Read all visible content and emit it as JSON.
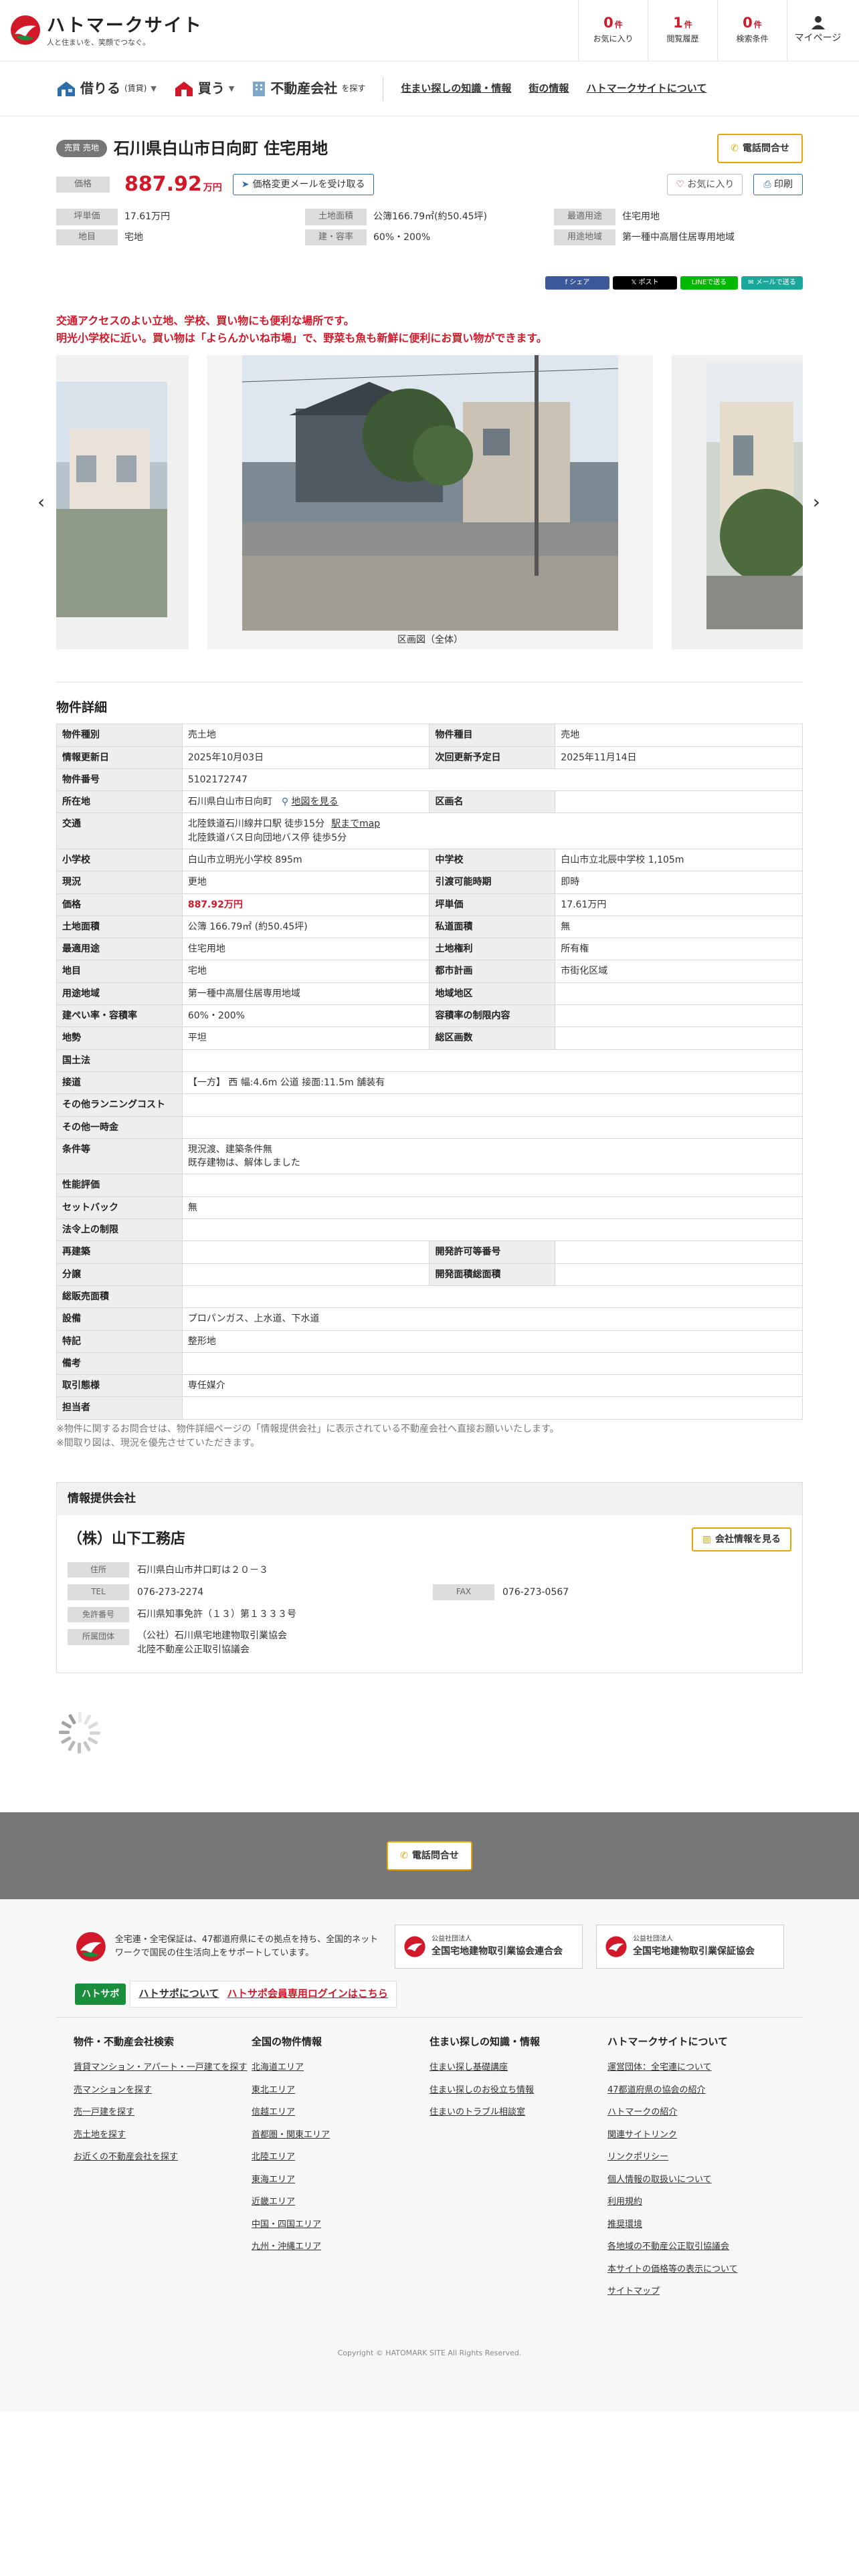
{
  "header": {
    "logo_name": "ハトマークサイト",
    "logo_tagline": "人と住まいを、笑顔でつなぐ。",
    "stats": [
      {
        "count": "0",
        "unit": "件",
        "label": "お気に入り"
      },
      {
        "count": "1",
        "unit": "件",
        "label": "閲覧履歴"
      },
      {
        "count": "0",
        "unit": "件",
        "label": "検索条件"
      }
    ],
    "mypage_label": "マイページ"
  },
  "nav": {
    "rent": {
      "label": "借りる",
      "sub": "(賃貸)"
    },
    "buy": {
      "label": "買う"
    },
    "realtor": {
      "label": "不動産会社",
      "sub": "を探す"
    },
    "links": [
      "住まい探しの知識・情報",
      "街の情報",
      "ハトマークサイトについて"
    ]
  },
  "property": {
    "badge": "売買 売地",
    "title": "石川県白山市日向町 住宅用地",
    "tel_button": "電話問合せ",
    "price_label": "価格",
    "price_value": "887.92",
    "price_unit": "万円",
    "mail_button": "価格変更メールを受け取る",
    "fav_button": "お気に入り",
    "print_button": "印刷",
    "specs": [
      {
        "label": "坪単価",
        "value": "17.61万円"
      },
      {
        "label": "土地面積",
        "value": "公簿166.79㎡(約50.45坪)"
      },
      {
        "label": "最適用途",
        "value": "住宅用地"
      },
      {
        "label": "地目",
        "value": "宅地"
      },
      {
        "label": "建・容率",
        "value": "60%・200%"
      },
      {
        "label": "用途地域",
        "value": "第一種中高層住居専用地域"
      }
    ],
    "share": [
      "シェア",
      "ポスト",
      "LINEで送る",
      "メールで送る"
    ],
    "catch_lines": [
      "交通アクセスのよい立地、学校、買い物にも便利な場所です。",
      "明光小学校に近い。買い物は「よらんかいね市場」で、野菜も魚も新鮮に便利にお買い物ができます。"
    ],
    "gallery_caption": "区画図（全体）"
  },
  "detail": {
    "title": "物件詳細",
    "map_link": "地図を見る",
    "route_link": "駅までmap",
    "rows": [
      [
        {
          "k": "物件種別",
          "v": "売土地"
        },
        {
          "k": "物件種目",
          "v": "売地"
        }
      ],
      [
        {
          "k": "情報更新日",
          "v": "2025年10月03日"
        },
        {
          "k": "次回更新予定日",
          "v": "2025年11月14日"
        }
      ],
      [
        {
          "k": "物件番号",
          "v": "5102172747",
          "span": true
        }
      ],
      [
        {
          "k": "所在地",
          "v": "石川県白山市日向町",
          "map": true
        },
        {
          "k": "区画名",
          "v": ""
        }
      ],
      [
        {
          "k": "交通",
          "v": "北陸鉄道石川線井口駅 徒歩15分",
          "v2": "北陸鉄道バス日向団地バス停 徒歩5分",
          "route": true,
          "span": true
        }
      ],
      [
        {
          "k": "小学校",
          "v": "白山市立明光小学校 895m"
        },
        {
          "k": "中学校",
          "v": "白山市立北辰中学校 1,105m"
        }
      ],
      [
        {
          "k": "現況",
          "v": "更地"
        },
        {
          "k": "引渡可能時期",
          "v": "即時"
        }
      ],
      [
        {
          "k": "価格",
          "v": "887.92万円",
          "red": true
        },
        {
          "k": "坪単価",
          "v": "17.61万円"
        }
      ],
      [
        {
          "k": "土地面積",
          "v": "公簿 166.79㎡ (約50.45坪)"
        },
        {
          "k": "私道面積",
          "v": "無"
        }
      ],
      [
        {
          "k": "最適用途",
          "v": "住宅用地"
        },
        {
          "k": "土地権利",
          "v": "所有権"
        }
      ],
      [
        {
          "k": "地目",
          "v": "宅地"
        },
        {
          "k": "都市計画",
          "v": "市街化区域"
        }
      ],
      [
        {
          "k": "用途地域",
          "v": "第一種中高層住居専用地域"
        },
        {
          "k": "地域地区",
          "v": ""
        }
      ],
      [
        {
          "k": "建ぺい率・容積率",
          "v": "60%・200%"
        },
        {
          "k": "容積率の制限内容",
          "v": ""
        }
      ],
      [
        {
          "k": "地勢",
          "v": "平坦"
        },
        {
          "k": "総区画数",
          "v": ""
        }
      ],
      [
        {
          "k": "国土法",
          "v": "",
          "span": true
        }
      ],
      [
        {
          "k": "接道",
          "v": "【一方】 西 幅:4.6m 公道 接面:11.5m 舗装有",
          "span": true
        }
      ],
      [
        {
          "k": "その他ランニングコスト",
          "v": "",
          "span": true
        }
      ],
      [
        {
          "k": "その他一時金",
          "v": "",
          "span": true
        }
      ],
      [
        {
          "k": "条件等",
          "v": "現況渡、建築条件無",
          "v2": "既存建物は、解体しました",
          "span": true
        }
      ],
      [
        {
          "k": "性能評価",
          "v": "",
          "span": true
        }
      ],
      [
        {
          "k": "セットバック",
          "v": "無",
          "span": true
        }
      ],
      [
        {
          "k": "法令上の制限",
          "v": "",
          "span": true
        }
      ],
      [
        {
          "k": "再建築",
          "v": ""
        },
        {
          "k": "開発許可等番号",
          "v": ""
        }
      ],
      [
        {
          "k": "分譲",
          "v": ""
        },
        {
          "k": "開発面積総面積",
          "v": ""
        }
      ],
      [
        {
          "k": "総販売面積",
          "v": "",
          "span": true
        }
      ],
      [
        {
          "k": "設備",
          "v": "プロパンガス、上水道、下水道",
          "span": true
        }
      ],
      [
        {
          "k": "特記",
          "v": "整形地",
          "span": true
        }
      ],
      [
        {
          "k": "備考",
          "v": "",
          "span": true
        }
      ],
      [
        {
          "k": "取引態様",
          "v": "専任媒介",
          "span": true
        }
      ],
      [
        {
          "k": "担当者",
          "v": "",
          "span": true
        }
      ]
    ],
    "notes": [
      "※物件に関するお問合せは、物件詳細ページの「情報提供会社」に表示されている不動産会社へ直接お願いいたします。",
      "※間取り図は、現況を優先させていただきます。"
    ]
  },
  "company": {
    "section_title": "情報提供会社",
    "name": "（株）山下工務店",
    "info_button": "会社情報を見る",
    "address_label": "住所",
    "address": "石川県白山市井口町は２０－３",
    "tel_label": "TEL",
    "tel": "076-273-2274",
    "fax_label": "FAX",
    "fax": "076-273-0567",
    "license_label": "免許番号",
    "license": "石川県知事免許（１３）第１３３３号",
    "group_label": "所属団体",
    "group_1": "（公社）石川県宅地建物取引業協会",
    "group_2": "北陸不動産公正取引協議会"
  },
  "footer": {
    "tel_button": "電話問合せ",
    "desc": "全宅連・全宅保証は、47都道府県にその拠点を持ち、全国的ネットワークで国民の住生活向上をサポートしています。",
    "assoc_1_small": "公益社団法人",
    "assoc_1": "全国宅地建物取引業協会連合会",
    "assoc_2_small": "公益社団法人",
    "assoc_2": "全国宅地建物取引業保証協会",
    "hatosapo_logo": "ハトサポ",
    "hatosapo_about": "ハトサポについて",
    "hatosapo_login": "ハトサポ会員専用ログインはこちら",
    "columns": [
      {
        "title": "物件・不動産会社検索",
        "links": [
          "賃貸マンション・アパート・一戸建てを探す",
          "売マンションを探す",
          "売一戸建を探す",
          "売土地を探す",
          "お近くの不動産会社を探す"
        ]
      },
      {
        "title": "全国の物件情報",
        "links": [
          "北海道エリア",
          "東北エリア",
          "信越エリア",
          "首都圏・関東エリア",
          "北陸エリア",
          "東海エリア",
          "近畿エリア",
          "中国・四国エリア",
          "九州・沖縄エリア"
        ]
      },
      {
        "title": "住まい探しの知識・情報",
        "links": [
          "住まい探し基礎講座",
          "住まい探しのお役立ち情報",
          "住まいのトラブル相談室"
        ]
      },
      {
        "title": "ハトマークサイトについて",
        "links": [
          "運営団体：全宅連について",
          "47都道府県の協会の紹介",
          "ハトマークの紹介",
          "関連サイトリンク",
          "リンクポリシー",
          "個人情報の取扱いについて",
          "利用規約",
          "推奨環境",
          "各地域の不動産公正取引協議会",
          "本サイトの価格等の表示について",
          "サイトマップ"
        ]
      }
    ],
    "copyright": "Copyright © HATOMARK SITE All Rights Reserved."
  },
  "colors": {
    "accent": "#d2192a",
    "tel": "#e6a400",
    "link_blue": "#2e6ea8"
  }
}
